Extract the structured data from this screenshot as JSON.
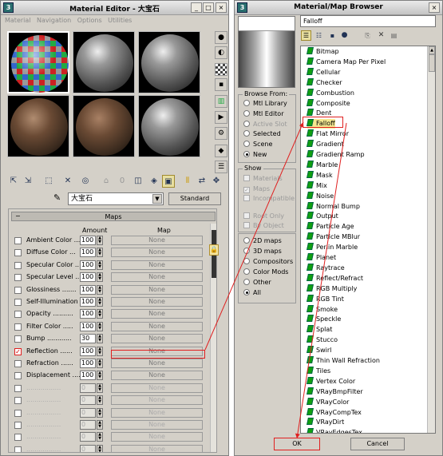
{
  "material_editor": {
    "title": "Material Editor - 大宝石",
    "menu": [
      "Material",
      "Navigation",
      "Options",
      "Utilities"
    ],
    "material_name": "大宝石",
    "material_type": "Standard",
    "maps_title": "Maps",
    "col_amount": "Amount",
    "col_map": "Map",
    "rows": [
      {
        "label": "Ambient Color ...",
        "amount": "100",
        "map": "None",
        "checked": false,
        "enabled": true
      },
      {
        "label": "Diffuse Color ...",
        "amount": "100",
        "map": "None",
        "checked": false,
        "enabled": true
      },
      {
        "label": "Specular Color ..",
        "amount": "100",
        "map": "None",
        "checked": false,
        "enabled": true
      },
      {
        "label": "Specular Level ..",
        "amount": "100",
        "map": "None",
        "checked": false,
        "enabled": true
      },
      {
        "label": "Glossiness .......",
        "amount": "100",
        "map": "None",
        "checked": false,
        "enabled": true
      },
      {
        "label": "Self-Illumination .",
        "amount": "100",
        "map": "None",
        "checked": false,
        "enabled": true
      },
      {
        "label": "Opacity ..........",
        "amount": "100",
        "map": "None",
        "checked": false,
        "enabled": true
      },
      {
        "label": "Filter Color .....",
        "amount": "100",
        "map": "None",
        "checked": false,
        "enabled": true
      },
      {
        "label": "Bump ............",
        "amount": "30",
        "map": "None",
        "checked": false,
        "enabled": true
      },
      {
        "label": "Reflection ......",
        "amount": "100",
        "map": "None",
        "checked": true,
        "enabled": true
      },
      {
        "label": "Refraction ......",
        "amount": "100",
        "map": "None",
        "checked": false,
        "enabled": true
      },
      {
        "label": "Displacement ....",
        "amount": "100",
        "map": "None",
        "checked": false,
        "enabled": true
      },
      {
        "label": ".................",
        "amount": "0",
        "map": "None",
        "checked": false,
        "enabled": false
      },
      {
        "label": ".................",
        "amount": "0",
        "map": "None",
        "checked": false,
        "enabled": false
      },
      {
        "label": ".................",
        "amount": "0",
        "map": "None",
        "checked": false,
        "enabled": false
      },
      {
        "label": ".................",
        "amount": "0",
        "map": "None",
        "checked": false,
        "enabled": false
      },
      {
        "label": ".................",
        "amount": "0",
        "map": "None",
        "checked": false,
        "enabled": false
      },
      {
        "label": ".................",
        "amount": "0",
        "map": "None",
        "checked": false,
        "enabled": false
      }
    ],
    "sample_slots": [
      "checker-sphere",
      "gray-sphere",
      "gray-sphere",
      "stone-sphere",
      "stone-sphere",
      "gray-sphere"
    ]
  },
  "map_browser": {
    "title": "Material/Map Browser",
    "selected_name": "Falloff",
    "browse_from_title": "Browse From:",
    "browse_from": [
      {
        "label": "Mtl Library",
        "selected": false,
        "enabled": true
      },
      {
        "label": "Mtl Editor",
        "selected": false,
        "enabled": true
      },
      {
        "label": "Active Slot",
        "selected": false,
        "enabled": false
      },
      {
        "label": "Selected",
        "selected": false,
        "enabled": true
      },
      {
        "label": "Scene",
        "selected": false,
        "enabled": true
      },
      {
        "label": "New",
        "selected": true,
        "enabled": true
      }
    ],
    "show_title": "Show",
    "show": [
      {
        "label": "Materials",
        "checked": false
      },
      {
        "label": "Maps",
        "checked": true
      },
      {
        "label": "Incompatible",
        "checked": false
      }
    ],
    "root_only": "Root Only",
    "by_object": "By Object",
    "map_types": [
      {
        "label": "2D maps",
        "selected": false
      },
      {
        "label": "3D maps",
        "selected": false
      },
      {
        "label": "Compositors",
        "selected": false
      },
      {
        "label": "Color Mods",
        "selected": false
      },
      {
        "label": "Other",
        "selected": false
      },
      {
        "label": "All",
        "selected": true
      }
    ],
    "items": [
      "Bitmap",
      "Camera Map Per Pixel",
      "Cellular",
      "Checker",
      "Combustion",
      "Composite",
      "Dent",
      "Falloff",
      "Flat Mirror",
      "Gradient",
      "Gradient Ramp",
      "Marble",
      "Mask",
      "Mix",
      "Noise",
      "Normal Bump",
      "Output",
      "Particle Age",
      "Particle MBlur",
      "Perlin Marble",
      "Planet",
      "Raytrace",
      "Reflect/Refract",
      "RGB Multiply",
      "RGB Tint",
      "Smoke",
      "Speckle",
      "Splat",
      "Stucco",
      "Swirl",
      "Thin Wall Refraction",
      "Tiles",
      "Vertex Color",
      "VRayBmpFilter",
      "VRayColor",
      "VRayCompTex",
      "VRayDirt",
      "VRayEdgesTex"
    ],
    "ok_label": "OK",
    "cancel_label": "Cancel"
  },
  "colors": {
    "highlight": "#e02020",
    "item_icon": "#10a010"
  }
}
